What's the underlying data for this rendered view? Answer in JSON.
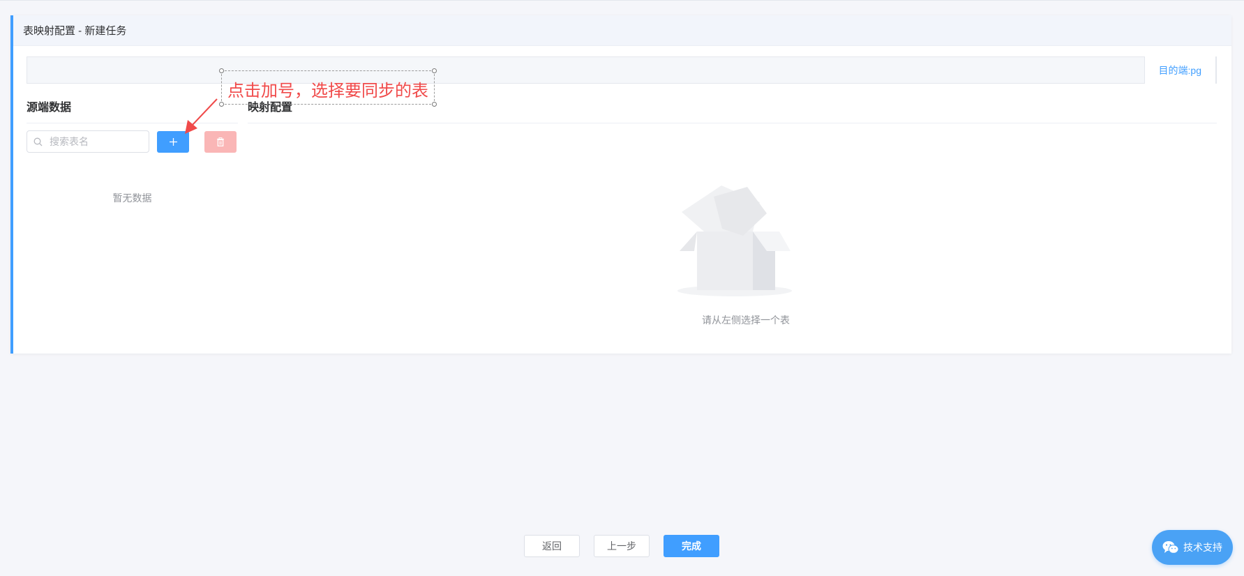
{
  "header": {
    "title": "表映射配置 - 新建任务"
  },
  "tabs": {
    "target_label": "目的端:pg"
  },
  "source": {
    "title": "源端数据",
    "search_placeholder": "搜索表名",
    "empty_text": "暂无数据"
  },
  "mapping": {
    "title": "映射配置",
    "empty_text": "请从左侧选择一个表"
  },
  "annotation": {
    "text": "点击加号，选择要同步的表"
  },
  "footer": {
    "back_label": "返回",
    "prev_label": "上一步",
    "done_label": "完成"
  },
  "support": {
    "label": "技术支持"
  },
  "icons": {
    "search": "search-icon",
    "add": "plus-icon",
    "delete": "trash-icon",
    "support": "wechat-icon"
  },
  "colors": {
    "accent": "#409eff",
    "danger_disabled": "#fab6b6",
    "annotation": "#f04a4a",
    "support": "#4aa2f5"
  }
}
